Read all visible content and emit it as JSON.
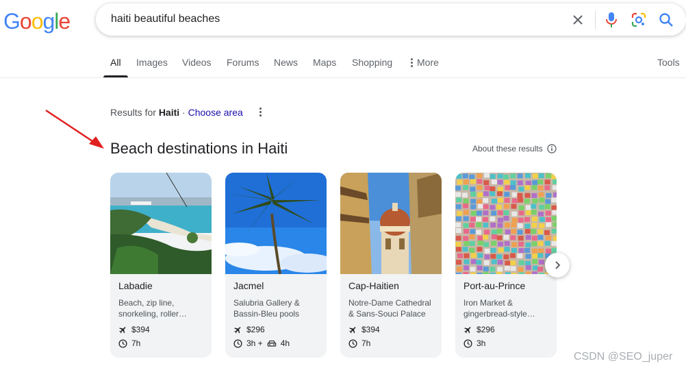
{
  "logo": {
    "letters": [
      "G",
      "o",
      "o",
      "g",
      "l",
      "e"
    ],
    "colors": [
      "#4285F4",
      "#EA4335",
      "#FBBC05",
      "#4285F4",
      "#34A853",
      "#EA4335"
    ]
  },
  "search": {
    "query": "haiti beautiful beaches"
  },
  "tabs": [
    {
      "label": "All",
      "active": true
    },
    {
      "label": "Images"
    },
    {
      "label": "Videos"
    },
    {
      "label": "Forums"
    },
    {
      "label": "News"
    },
    {
      "label": "Maps"
    },
    {
      "label": "Shopping"
    },
    {
      "label": "More"
    }
  ],
  "tools_label": "Tools",
  "results_for": {
    "prefix": "Results for",
    "place": "Haiti",
    "separator": "·",
    "link": "Choose area"
  },
  "section": {
    "title": "Beach destinations in Haiti",
    "about": "About these results"
  },
  "cards": [
    {
      "name": "Labadie",
      "desc_line1": "Beach, zip line,",
      "desc_line2": "snorkeling, roller…",
      "price": "$394",
      "time": "7h",
      "time_extra": ""
    },
    {
      "name": "Jacmel",
      "desc_line1": "Salubria Gallery &",
      "desc_line2": "Bassin-Bleu pools",
      "price": "$296",
      "time": "3h +",
      "time_extra": "4h"
    },
    {
      "name": "Cap-Haitien",
      "desc_line1": "Notre-Dame Cathedral",
      "desc_line2": "& Sans-Souci Palace",
      "price": "$394",
      "time": "7h",
      "time_extra": ""
    },
    {
      "name": "Port-au-Prince",
      "desc_line1": "Iron Market &",
      "desc_line2": "gingerbread-style…",
      "price": "$296",
      "time": "3h",
      "time_extra": ""
    }
  ],
  "watermark": "CSDN @SEO_juper",
  "colors": {
    "link": "#1a0dab",
    "annotation_arrow": "#e02020"
  }
}
